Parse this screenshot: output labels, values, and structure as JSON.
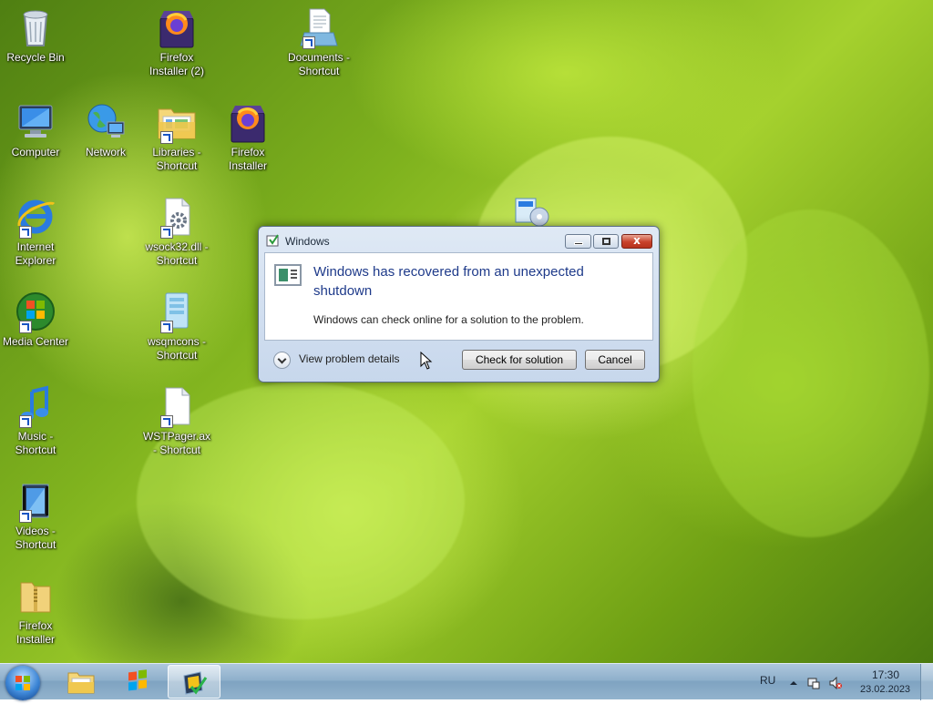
{
  "desktop": {
    "icons": [
      {
        "label": "Recycle Bin",
        "icon": "recycle-bin-icon"
      },
      {
        "label": "Firefox\nInstaller (2)",
        "icon": "firefox-installer-icon"
      },
      {
        "label": "Documents -\nShortcut",
        "icon": "documents-icon"
      },
      {
        "label": "Computer",
        "icon": "computer-icon"
      },
      {
        "label": "Network",
        "icon": "network-icon"
      },
      {
        "label": "Libraries -\nShortcut",
        "icon": "libraries-folder-icon"
      },
      {
        "label": "Firefox\nInstaller",
        "icon": "firefox-installer-icon"
      },
      {
        "label": "Internet\nExplorer",
        "icon": "internet-explorer-icon"
      },
      {
        "label": "wsock32.dll -\nShortcut",
        "icon": "dll-file-icon"
      },
      {
        "label": "Media Center",
        "icon": "media-center-icon"
      },
      {
        "label": "wsqmcons -\nShortcut",
        "icon": "exe-file-icon"
      },
      {
        "label": "Music -\nShortcut",
        "icon": "music-icon"
      },
      {
        "label": "WSTPager.ax\n- Shortcut",
        "icon": "blank-file-icon"
      },
      {
        "label": "Videos -\nShortcut",
        "icon": "videos-icon"
      },
      {
        "label": "Firefox\nInstaller",
        "icon": "zip-folder-icon"
      }
    ]
  },
  "dialog": {
    "title": "Windows",
    "heading": "Windows has recovered from an unexpected shutdown",
    "body": "Windows can check online for a solution to the problem.",
    "details_label": "View problem details",
    "check_button": "Check for solution",
    "cancel_button": "Cancel",
    "close_glyph": "x"
  },
  "taskbar": {
    "language": "RU",
    "time": "17:30",
    "date": "23.02.2023",
    "items": [
      "explorer-icon",
      "windows-update-icon",
      "problem-reports-icon"
    ]
  }
}
